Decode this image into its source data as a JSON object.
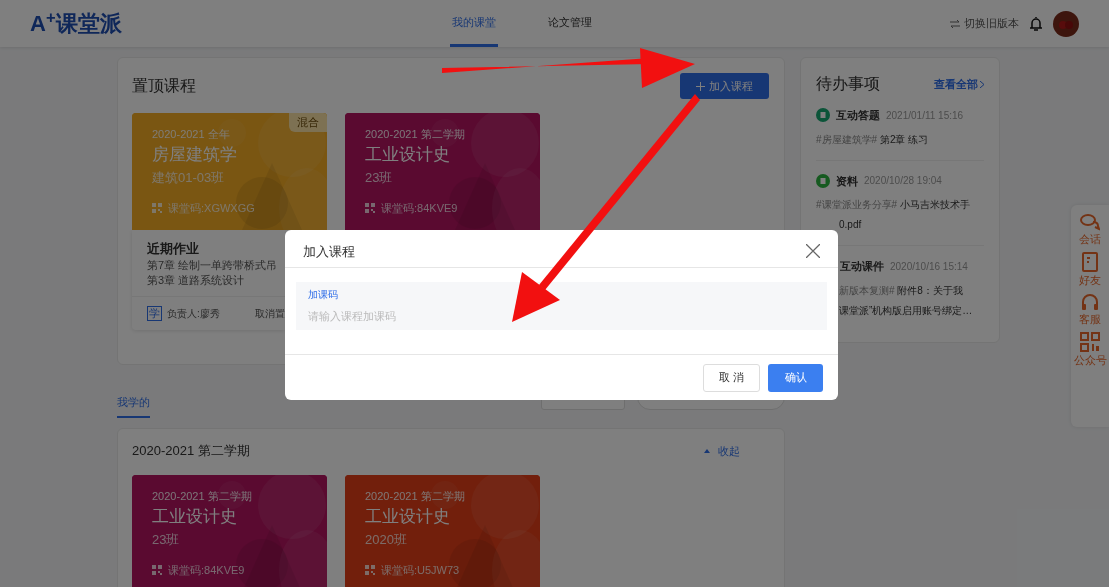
{
  "header": {
    "logo": "A$^{+}$课堂派",
    "nav": [
      {
        "label": "我的课堂",
        "selected": true
      },
      {
        "label": "论文管理",
        "selected": false
      }
    ],
    "switch_version": "切换旧版本"
  },
  "pinned": {
    "title": "置顶课程",
    "join_button": "加入课程",
    "cards": [
      {
        "color": "#7a5612",
        "term": "2020-2021 全年",
        "name": "房屋建筑学",
        "class": "建筑01-03班",
        "code": "课堂码:XGWXGG",
        "badge": "混合",
        "homework": {
          "title": "近期作业",
          "lines": [
            "第7章 绘制一单跨带桥式吊",
            "第3章 道路系统设计"
          ],
          "owner_icon": "学",
          "owner": "负责人:廖秀",
          "action": "取消置"
        }
      },
      {
        "color": "#5a0a30",
        "term": "2020-2021 第二学期",
        "name": "工业设计史",
        "class": "23班",
        "code": "课堂码:84KVE9"
      }
    ]
  },
  "todo": {
    "title": "待办事项",
    "view_all": "查看全部",
    "items": [
      {
        "kind": "full",
        "color": "#0c5439",
        "type": "互动答题",
        "time": "2021/01/11 15:16",
        "lines": [
          {
            "tag": "#房屋建筑学#",
            "text": "第2章 练习",
            "covered": false
          }
        ]
      },
      {
        "kind": "full",
        "color": "#165a20",
        "type": "资料",
        "time": "2020/10/28 19:04",
        "lines": [
          {
            "tag": "#课堂派业务分享#",
            "text": "小马吉米技术手",
            "covered": false
          },
          {
            "text": "0.pdf",
            "covered": true
          }
        ]
      },
      {
        "kind": "covered",
        "type": "互动课件",
        "time": "2020/10/16 15:14",
        "lines": [
          {
            "tag": "新版本复测#",
            "text": "附件8：关于我",
            "covered": true
          },
          {
            "text": "课堂派”机构版启用账号绑定…",
            "covered": true
          }
        ]
      }
    ]
  },
  "side_rail": [
    {
      "kind": "chat",
      "label": "会话"
    },
    {
      "kind": "friends",
      "label": "好友"
    },
    {
      "kind": "service",
      "label": "客服"
    },
    {
      "kind": "qr",
      "label": "公众号"
    }
  ],
  "learning_tab": {
    "label": "我学的",
    "selected": true
  },
  "semester": {
    "title": "2020-2021 第二学期",
    "collapse": "收起",
    "cards": [
      {
        "color": "#5a0a30",
        "term": "2020-2021 第二学期",
        "name": "工业设计史",
        "class": "23班",
        "code": "课堂码:84KVE9"
      },
      {
        "color": "#721f0c",
        "term": "2020-2021 第二学期",
        "name": "工业设计史",
        "class": "2020班",
        "code": "课堂码:U5JW73"
      }
    ]
  },
  "dialog": {
    "title": "加入课程",
    "field_label": "加课码",
    "placeholder": "请输入课程加课码",
    "cancel": "取 消",
    "confirm": "确认"
  }
}
